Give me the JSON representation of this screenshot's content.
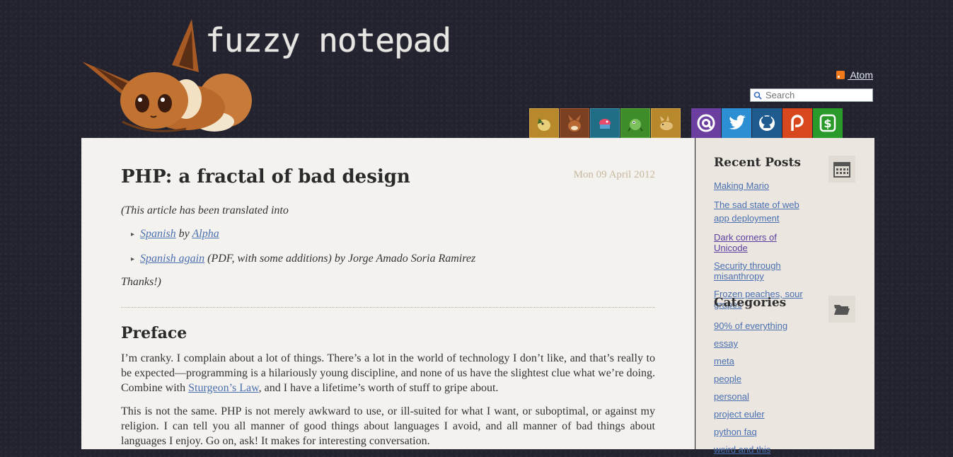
{
  "site": {
    "title": "fuzzy notepad",
    "atom_label": " Atom"
  },
  "search": {
    "placeholder": "Search"
  },
  "social": [
    {
      "name": "pokemon-1-icon",
      "bg": "#b8892c"
    },
    {
      "name": "pokemon-2-icon",
      "bg": "#7b3f22"
    },
    {
      "name": "pokemon-3-icon",
      "bg": "#1f6e86"
    },
    {
      "name": "pokemon-4-icon",
      "bg": "#3f8c2a"
    },
    {
      "name": "pokemon-5-icon",
      "bg": "#b8892c"
    },
    {
      "name": "email-icon",
      "bg": "#6b3fa0"
    },
    {
      "name": "twitter-icon",
      "bg": "#2d8fd3"
    },
    {
      "name": "github-icon",
      "bg": "#1f5b8f"
    },
    {
      "name": "patreon-icon",
      "bg": "#d8481f"
    },
    {
      "name": "donate-icon",
      "bg": "#2a9a2a"
    }
  ],
  "post": {
    "title": "PHP: a fractal of bad design",
    "date": "Mon 09 April 2012",
    "intro": "(This article has been translated into",
    "translations": [
      {
        "link": "Spanish",
        "mid": " by ",
        "link2": "Alpha",
        "rest": ""
      },
      {
        "link": "Spanish again",
        "mid": " (PDF, with some additions) by Jorge Amado Soria Ramirez",
        "link2": "",
        "rest": ""
      }
    ],
    "thanks": "Thanks!)",
    "heading": "Preface",
    "para1_a": "I’m cranky. I complain about a lot of things. There’s a lot in the world of technology I don’t like, and that’s really to be expected—programming is a hilariously young discipline, and none of us have the slightest clue what we’re doing. Combine with ",
    "para1_link": "Sturgeon’s Law",
    "para1_b": ", and I have a lifetime’s worth of stuff to gripe about.",
    "para2": "This is not the same. PHP is not merely awkward to use, or ill-suited for what I want, or suboptimal, or against my religion. I can tell you all manner of good things about languages I avoid, and all manner of bad things about languages I enjoy. Go on, ask! It makes for interesting conversation."
  },
  "sidebar": {
    "recent_title": "Recent Posts",
    "recent": [
      "Making Mario",
      "The sad state of web app deployment",
      "Dark corners of Unicode",
      "Security through misanthropy",
      "Frozen peaches, sour grapes"
    ],
    "categories_title": "Categories",
    "categories": [
      "90% of everything",
      "essay",
      "meta",
      "people",
      "personal",
      "project euler",
      "python faq",
      "weird and this"
    ]
  }
}
